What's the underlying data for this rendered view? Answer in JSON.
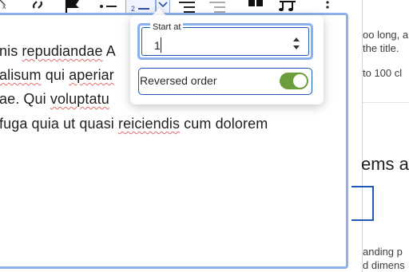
{
  "toolbar": {
    "buttons": [
      "clear-formatting",
      "link",
      "flag",
      "bulleted-list",
      "numbered-list",
      "list-options",
      "indent",
      "outdent",
      "insert-block",
      "music",
      "more"
    ]
  },
  "editor": {
    "lines": [
      {
        "pre": "nis ",
        "spell": "repudiandae",
        "post": " A"
      },
      {
        "pre": "",
        "spell": "alisum",
        "post": " qui ",
        "spell2": "aperiar"
      },
      {
        "pre": "ae. Qui ",
        "spell": "voluptatu",
        "post": ""
      },
      {
        "pre": " fuga quia ut quasi ",
        "spell": "reiciendis",
        "post": " cum dolorem"
      }
    ]
  },
  "popover": {
    "start_label": "Start at",
    "start_value": "1",
    "reversed_label": "Reversed order",
    "reversed_on": true
  },
  "side": {
    "line1": "oo long, a",
    "line2": " the title.",
    "line3": "to 100 cl",
    "heading": "ems a",
    "line4": "anding p",
    "line5": "d dimens"
  },
  "colors": {
    "accent": "#1d5ab5",
    "focus_ring": "#8ab0ee",
    "toggle_on": "#6b9e3a",
    "spellcheck": "#e36b6b"
  }
}
